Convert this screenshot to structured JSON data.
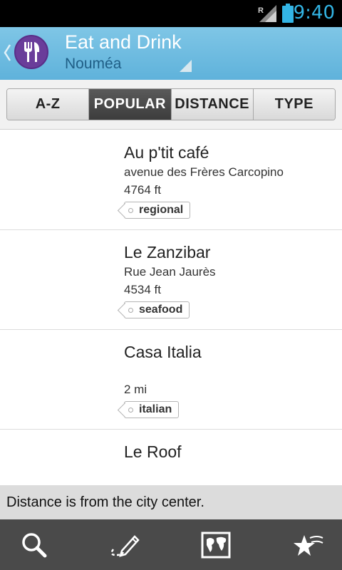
{
  "status_bar": {
    "time": "9:40",
    "network_label": "R"
  },
  "header": {
    "title": "Eat and Drink",
    "subtitle": "Nouméa",
    "app_icon": "fork-knife-icon"
  },
  "tabs": [
    {
      "label": "A-Z",
      "active": false
    },
    {
      "label": "POPULAR",
      "active": true
    },
    {
      "label": "DISTANCE",
      "active": false
    },
    {
      "label": "TYPE",
      "active": false
    }
  ],
  "places": [
    {
      "name": "Au p'tit café",
      "address": "avenue des Frères Carcopino",
      "distance": "4764 ft",
      "tag": "regional"
    },
    {
      "name": "Le Zanzibar",
      "address": "Rue Jean Jaurès",
      "distance": "4534 ft",
      "tag": "seafood"
    },
    {
      "name": "Casa Italia",
      "address": "",
      "distance": "2 mi",
      "tag": "italian"
    },
    {
      "name": "Le Roof",
      "address": "",
      "distance": "",
      "tag": ""
    }
  ],
  "notice": "Distance is from the city center.",
  "bottom_bar": {
    "icons": [
      "search-icon",
      "edit-icon",
      "map-icon",
      "favorites-icon"
    ]
  },
  "colors": {
    "action_bar": "#6ab9df",
    "app_icon_bg": "#6a3d9a",
    "clock": "#33b5e5",
    "active_tab": "#4a4a4a"
  }
}
